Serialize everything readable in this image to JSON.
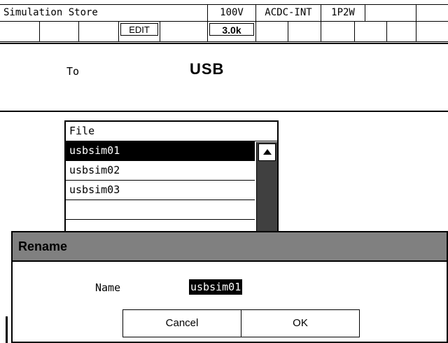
{
  "header": {
    "title": "Simulation Store",
    "voltage": "100V",
    "mode": "ACDC-INT",
    "phase": "1P2W"
  },
  "softkeys": {
    "edit_label": "EDIT",
    "freq_label": "3.0k"
  },
  "destination": {
    "label": "To",
    "value": "USB"
  },
  "file_list": {
    "header": "File",
    "items": [
      "usbsim01",
      "usbsim02",
      "usbsim03",
      ""
    ],
    "selected_index": 0
  },
  "rename_dialog": {
    "title": "Rename",
    "name_label": "Name",
    "name_value": "usbsim01",
    "cancel_label": "Cancel",
    "ok_label": "OK"
  }
}
